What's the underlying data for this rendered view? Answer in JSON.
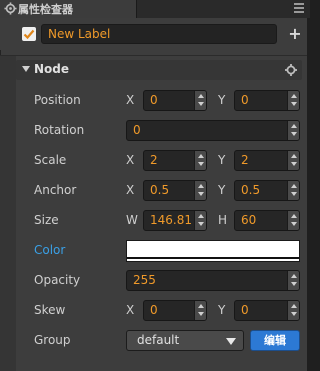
{
  "window": {
    "tab_title": "属性检查器",
    "tab_icon": "gear-icon",
    "menu_icon": "hamburger-menu-icon"
  },
  "node_header": {
    "active_checked": true,
    "name_value": "New Label",
    "add_icon": "plus-icon"
  },
  "section": {
    "title": "Node",
    "collapse_icon": "triangle-down-icon",
    "settings_icon": "gear-icon"
  },
  "props": {
    "position": {
      "label": "Position",
      "x_label": "X",
      "x": "0",
      "y_label": "Y",
      "y": "0"
    },
    "rotation": {
      "label": "Rotation",
      "value": "0"
    },
    "scale": {
      "label": "Scale",
      "x_label": "X",
      "x": "2",
      "y_label": "Y",
      "y": "2"
    },
    "anchor": {
      "label": "Anchor",
      "x_label": "X",
      "x": "0.5",
      "y_label": "Y",
      "y": "0.5"
    },
    "size": {
      "label": "Size",
      "w_label": "W",
      "w": "146.81",
      "h_label": "H",
      "h": "60"
    },
    "color": {
      "label": "Color",
      "value": "#ffffff"
    },
    "opacity": {
      "label": "Opacity",
      "value": "255"
    },
    "skew": {
      "label": "Skew",
      "x_label": "X",
      "x": "0",
      "y_label": "Y",
      "y": "0"
    },
    "group": {
      "label": "Group",
      "selected": "default",
      "edit_label": "编辑"
    }
  },
  "colors": {
    "accent_value": "#f09a2a",
    "label_highlight": "#3aa0e6",
    "edit_button": "#2c79d4"
  }
}
